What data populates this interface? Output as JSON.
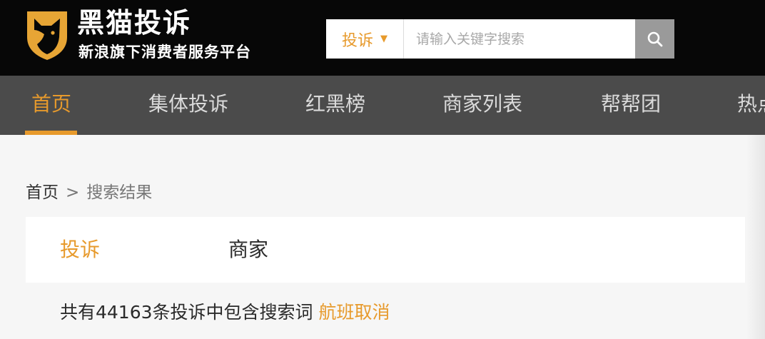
{
  "header": {
    "logo_title": "黑猫投诉",
    "logo_subtitle": "新浪旗下消费者服务平台",
    "logo_icon": "cat-shield-icon",
    "search": {
      "type_selected": "投诉",
      "placeholder": "请输入关键字搜索",
      "value": ""
    }
  },
  "nav": {
    "items": [
      {
        "label": "首页",
        "active": true
      },
      {
        "label": "集体投诉"
      },
      {
        "label": "红黑榜"
      },
      {
        "label": "商家列表"
      },
      {
        "label": "帮帮团"
      },
      {
        "label": "热点"
      }
    ]
  },
  "breadcrumb": {
    "home": "首页",
    "separator": ">",
    "current": "搜索结果"
  },
  "result_tabs": [
    {
      "label": "投诉",
      "active": true
    },
    {
      "label": "商家"
    }
  ],
  "result_summary": {
    "text": "共有44163条投诉中包含搜索词",
    "keyword": "航班取消"
  },
  "colors": {
    "accent": "#e79a2c",
    "header_bg": "#070707",
    "nav_bg": "#4b4b4b",
    "page_bg": "#f6f6f6"
  }
}
